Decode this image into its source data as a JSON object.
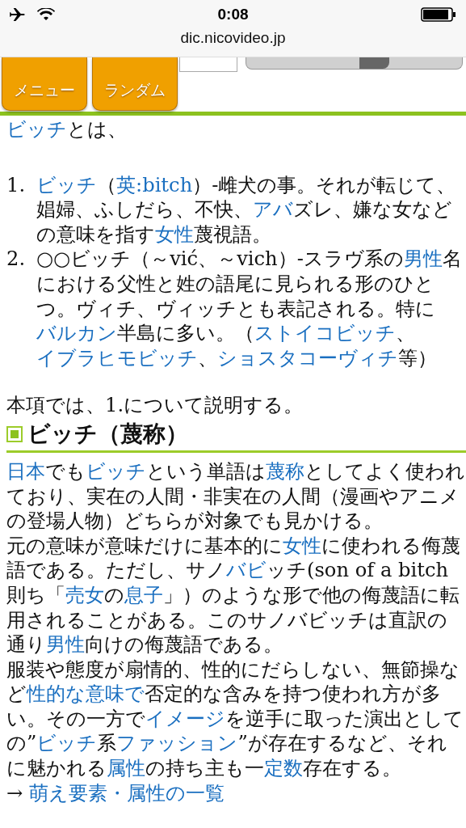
{
  "status_bar": {
    "time": "0:08"
  },
  "browser": {
    "url": "dic.nicovideo.jp"
  },
  "nav": {
    "tabs": [
      {
        "label": "メニュー"
      },
      {
        "label": "ランダム"
      }
    ]
  },
  "intro": [
    {
      "text": "ビッチ",
      "kind": "link"
    },
    {
      "text": "とは、",
      "kind": "text"
    }
  ],
  "meanings": [
    {
      "number": "1.",
      "segments": [
        {
          "text": "ビッチ",
          "kind": "link"
        },
        {
          "text": "（",
          "kind": "text"
        },
        {
          "text": "英:bitch",
          "kind": "link"
        },
        {
          "text": "）-雌犬の事。それが転じて、娼婦、ふしだら、不快、",
          "kind": "text"
        },
        {
          "text": "アバ",
          "kind": "link"
        },
        {
          "text": "ズレ、嫌な女などの意味を指す",
          "kind": "text"
        },
        {
          "text": "女性",
          "kind": "link"
        },
        {
          "text": "蔑視語。",
          "kind": "text"
        }
      ]
    },
    {
      "number": "2.",
      "segments": [
        {
          "text": "○○ビッチ（～vić、～vich）-スラヴ系の",
          "kind": "text"
        },
        {
          "text": "男性",
          "kind": "link"
        },
        {
          "text": "名における父性と姓の語尾に見られる形のひとつ。ヴィチ、ヴィッチとも表記される。特に",
          "kind": "text"
        },
        {
          "text": "バルカン",
          "kind": "link"
        },
        {
          "text": "半島に多い。（",
          "kind": "text"
        },
        {
          "text": "ストイコビッチ",
          "kind": "link"
        },
        {
          "text": "、",
          "kind": "text"
        },
        {
          "text": "イブラヒモビッチ",
          "kind": "link"
        },
        {
          "text": "、",
          "kind": "text"
        },
        {
          "text": "ショスタコーヴィチ",
          "kind": "link"
        },
        {
          "text": "等）",
          "kind": "text"
        }
      ]
    }
  ],
  "note": "本項では、1.について説明する。",
  "section": {
    "heading": "ビッチ（蔑称）",
    "paragraphs": [
      [
        {
          "text": "日本",
          "kind": "link"
        },
        {
          "text": "でも",
          "kind": "text"
        },
        {
          "text": "ビッチ",
          "kind": "link"
        },
        {
          "text": "という単語は",
          "kind": "text"
        },
        {
          "text": "蔑称",
          "kind": "link"
        },
        {
          "text": "としてよく使われており、実在の人間・非実在の人間（漫画やアニメの登場人物）どちらが対象でも見かける。",
          "kind": "text"
        }
      ],
      [
        {
          "text": "元の意味が意味だけに基本的に",
          "kind": "text"
        },
        {
          "text": "女性",
          "kind": "link"
        },
        {
          "text": "に使われる侮蔑語である。ただし、サノ",
          "kind": "text"
        },
        {
          "text": "バビ",
          "kind": "link"
        },
        {
          "text": "ッチ(son of a bitch　則ち「",
          "kind": "text"
        },
        {
          "text": "売女",
          "kind": "link"
        },
        {
          "text": "の",
          "kind": "text"
        },
        {
          "text": "息子",
          "kind": "link"
        },
        {
          "text": "」）のような形で他の侮蔑語に転用されることがある。このサノバビッチは直訳の通り",
          "kind": "text"
        },
        {
          "text": "男性",
          "kind": "link"
        },
        {
          "text": "向けの侮蔑語である。",
          "kind": "text"
        }
      ],
      [
        {
          "text": "服装や態度が扇情的、性的にだらしない、無節操など",
          "kind": "text"
        },
        {
          "text": "性的な意味で",
          "kind": "link"
        },
        {
          "text": "否定的な含みを持つ使われ方が多い。その一方で",
          "kind": "text"
        },
        {
          "text": "イメージ",
          "kind": "link"
        },
        {
          "text": "を逆手に取った演出としての”",
          "kind": "text"
        },
        {
          "text": "ビッチ",
          "kind": "link"
        },
        {
          "text": "系",
          "kind": "text"
        },
        {
          "text": "ファッション",
          "kind": "link"
        },
        {
          "text": "”が存在するなど、それに魅かれる",
          "kind": "text"
        },
        {
          "text": "属性",
          "kind": "link"
        },
        {
          "text": "の持ち主も一",
          "kind": "text"
        },
        {
          "text": "定数",
          "kind": "link"
        },
        {
          "text": "存在する。",
          "kind": "text"
        }
      ],
      [
        {
          "text": "→ ",
          "kind": "text"
        },
        {
          "text": "萌え要素・属性の一覧",
          "kind": "link"
        }
      ]
    ]
  }
}
